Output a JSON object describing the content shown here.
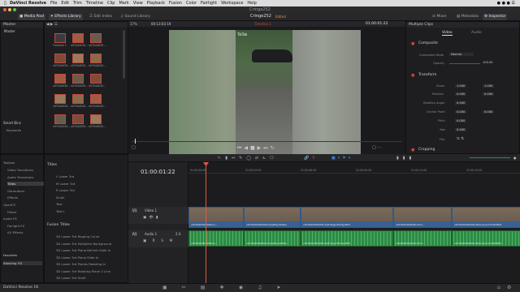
{
  "menubar": {
    "app": "DaVinci Resolve",
    "items": [
      "File",
      "Edit",
      "Trim",
      "Timeline",
      "Clip",
      "Mark",
      "View",
      "Playback",
      "Fusion",
      "Color",
      "Fairlight",
      "Workspace",
      "Help"
    ]
  },
  "window": {
    "title": "Cringe252"
  },
  "toolbar": {
    "media_pool": "Media Pool",
    "effects_library": "Effects Library",
    "edit_index": "Edit Index",
    "sound_library": "Sound Library",
    "project": "Cringe252",
    "edited": "Edited",
    "mixer": "Mixer",
    "metadata": "Metadata",
    "inspector": "Inspector"
  },
  "media_pool": {
    "master_label": "Master",
    "bin_master": "Master",
    "smart_bins": "Smart Bins",
    "keywords": "Keywords",
    "clips": [
      "Timeline 1",
      "v07044030...",
      "v07044030...",
      "v07044030...",
      "v07044030...",
      "v07044030...",
      "v07044030...",
      "v07044030...",
      "v07044030...",
      "v07044030...",
      "v07044030...",
      "v07044030...",
      "v07044030...",
      "v07044030...",
      "v07044030..."
    ]
  },
  "viewer": {
    "zoom": "37%",
    "timecode_left": "00:13:03:19",
    "timeline_name": "Timeline 1",
    "timecode_right": "01:00:01:22",
    "overlay_text": "TikTok"
  },
  "inspector": {
    "title": "Multiple Clips",
    "tab_video": "Video",
    "tab_audio": "Audio",
    "composite": "Composite",
    "composite_mode_label": "Composite Mode",
    "composite_mode_value": "Normal",
    "opacity_label": "Opacity",
    "opacity_value": "100.00",
    "transform": "Transform",
    "zoom_label": "Zoom",
    "zoom_x": "1.000",
    "zoom_y": "1.000",
    "position_label": "Position",
    "position_x": "0.000",
    "position_y": "0.000",
    "rotation_label": "Rotation Angle",
    "rotation_value": "0.000",
    "anchor_label": "Anchor Point",
    "anchor_x": "0.000",
    "anchor_y": "0.000",
    "pitch_label": "Pitch",
    "pitch_value": "0.000",
    "yaw_label": "Yaw",
    "yaw_value": "0.000",
    "flip_label": "Flip",
    "cropping": "Cropping"
  },
  "effects": {
    "toolbox": "Toolbox",
    "categories": [
      "Video Transitions",
      "Audio Transitions",
      "Titles",
      "Generators",
      "Effects",
      "OpenFX",
      "Filters",
      "Audio FX",
      "Fairlight FX",
      "AU Effects"
    ],
    "favorites": "Favorites",
    "favorite_item": "Blanking Fill",
    "titles_header": "Titles",
    "titles": [
      "L Lower 3rd",
      "M Lower 3rd",
      "R Lower 3rd",
      "Scroll",
      "Text",
      "Text+"
    ],
    "fusion_header": "Fusion Titles",
    "fusion_titles": [
      "3D Lower 3rd Ripping Curve",
      "3D Lower 3rd Multiplier Background",
      "3D Lower 3rd Plane Behind Glide In",
      "3D Lower 3rd Plane Slide In",
      "3D Lower 3rd Planes Rotating In",
      "3D Lower 3rd Rotating Plane 2 Line",
      "3D Lower 3rd Shelf"
    ]
  },
  "timeline": {
    "timecode": "01:00:01:22",
    "ruler": [
      "01:00:00:00",
      "01:00:03:00",
      "01:00:06:00",
      "01:00:09:00",
      "01:00:12:00",
      "01:00:15:00"
    ],
    "video_track": "Video 1",
    "video_id": "V1",
    "audio_track": "Audio 1",
    "audio_id": "A1",
    "audio_level": "2.0",
    "video_clips": [
      "v07044030000bmu...",
      "v07044030000bmuhytftaydb9bs...",
      "v07044030000bn7q07tjqpv8rddg.MP4",
      "v07044030000bnr0m...",
      "v07044030000bm8uhiysunnt7ia8.MP4",
      "v07044030000b..."
    ],
    "audio_clips": [
      "v07044030000bmu...",
      "v07044030000bmuhytftaydb9bs...",
      "v07044030000bn7q07tjqpv8rddg.MP4",
      "v07044030000bnr0m...",
      "v07044030000bm8uhiysunnt7ia8.MP4",
      "v07044030000b..."
    ]
  },
  "footer": {
    "app_version": "DaVinci Resolve 16"
  },
  "colors": {
    "accent_red": "#d0463a",
    "playhead": "#e05a3a",
    "video_clip": "#3a5f93",
    "audio_clip": "#2f8a45",
    "edited": "#e0913a"
  }
}
